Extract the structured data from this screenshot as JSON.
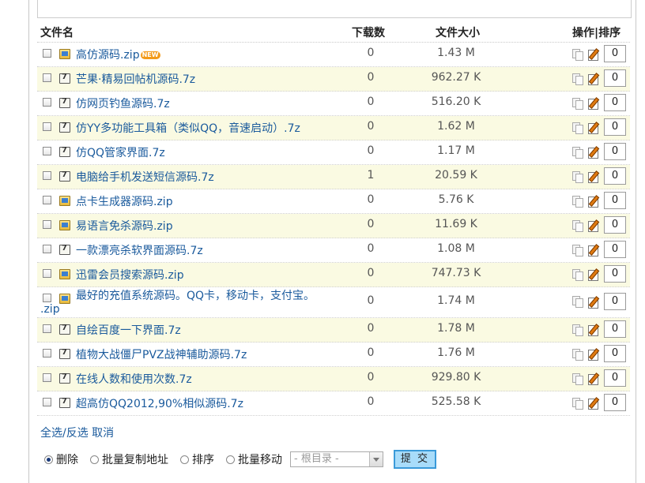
{
  "header": {
    "col_name": "文件名",
    "col_downloads": "下载数",
    "col_size": "文件大小",
    "col_actions": "操作|排序"
  },
  "files": [
    {
      "name": "高仿源码.zip",
      "type": "zip",
      "badge": "NEW",
      "downloads": "0",
      "size": "1.43 M",
      "sort": "0"
    },
    {
      "name": "芒果·精易回帖机源码.7z",
      "type": "7z",
      "downloads": "0",
      "size": "962.27 K",
      "sort": "0"
    },
    {
      "name": "仿网页钓鱼源码.7z",
      "type": "7z",
      "downloads": "0",
      "size": "516.20 K",
      "sort": "0"
    },
    {
      "name": "仿YY多功能工具箱（类似QQ，音速启动）.7z",
      "type": "7z",
      "downloads": "0",
      "size": "1.62 M",
      "sort": "0"
    },
    {
      "name": "仿QQ管家界面.7z",
      "type": "7z",
      "downloads": "0",
      "size": "1.17 M",
      "sort": "0"
    },
    {
      "name": "电脑给手机发送短信源码.7z",
      "type": "7z",
      "downloads": "1",
      "size": "20.59 K",
      "sort": "0"
    },
    {
      "name": "点卡生成器源码.zip",
      "type": "zip",
      "downloads": "0",
      "size": "5.76 K",
      "sort": "0"
    },
    {
      "name": "易语言免杀源码.zip",
      "type": "zip",
      "downloads": "0",
      "size": "11.69 K",
      "sort": "0"
    },
    {
      "name": "一款漂亮杀软界面源码.7z",
      "type": "7z",
      "downloads": "0",
      "size": "1.08 M",
      "sort": "0"
    },
    {
      "name": "迅雷会员搜索源码.zip",
      "type": "zip",
      "downloads": "0",
      "size": "747.73 K",
      "sort": "0"
    },
    {
      "name_line1": "最好的充值系统源码。QQ卡，移动卡，支付宝。",
      "name_line2": ".zip",
      "type": "zip",
      "downloads": "0",
      "size": "1.74 M",
      "sort": "0"
    },
    {
      "name": "自绘百度一下界面.7z",
      "type": "7z",
      "downloads": "0",
      "size": "1.78 M",
      "sort": "0"
    },
    {
      "name": "植物大战僵尸PVZ战神辅助源码.7z",
      "type": "7z",
      "downloads": "0",
      "size": "1.76 M",
      "sort": "0"
    },
    {
      "name": "在线人数和使用次数.7z",
      "type": "7z",
      "downloads": "0",
      "size": "929.80 K",
      "sort": "0"
    },
    {
      "name": "超高仿QQ2012,90%相似源码.7z",
      "type": "7z",
      "downloads": "0",
      "size": "525.58 K",
      "sort": "0"
    }
  ],
  "selection": {
    "select_all": "全选/反选",
    "cancel": "取消"
  },
  "bottom_bar": {
    "options": [
      "删除",
      "批量复制地址",
      "排序",
      "批量移动"
    ],
    "selected_option": "删除",
    "folder_select": "- 根目录 -",
    "submit": "提 交"
  }
}
